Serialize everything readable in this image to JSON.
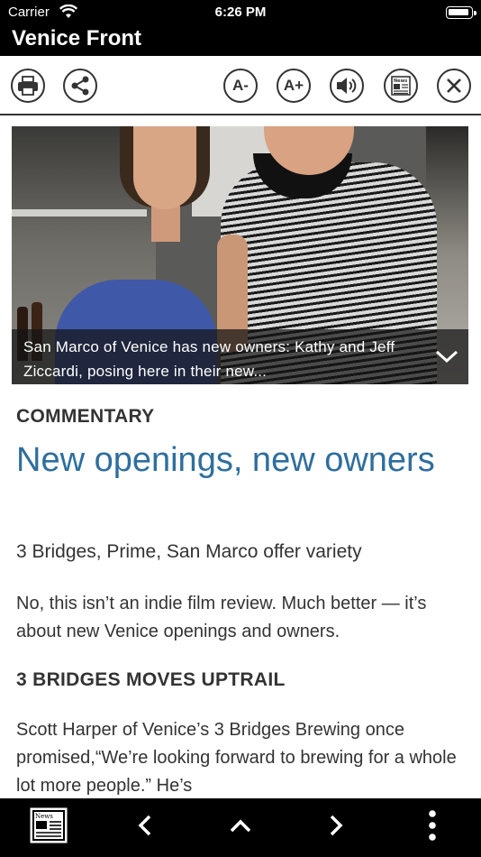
{
  "status_bar": {
    "carrier": "Carrier",
    "time": "6:26 PM"
  },
  "header": {
    "title": "Venice Front"
  },
  "toolbar": {
    "buttons": [
      {
        "icon": "print-icon"
      },
      {
        "icon": "share-icon"
      },
      {
        "label": "A-"
      },
      {
        "label": "A+"
      },
      {
        "icon": "speaker-icon"
      },
      {
        "icon": "news-icon",
        "label": "News"
      },
      {
        "icon": "close-icon"
      }
    ]
  },
  "hero": {
    "caption": "San Marco of Venice has new owners: Kathy and Jeff Ziccardi, posing here in their new..."
  },
  "article": {
    "kicker": "COMMENTARY",
    "headline": "New openings, new owners",
    "dek": "3 Bridges, Prime, San Marco offer variety",
    "paragraph1": "No, this isn’t an indie film review. Much better — it’s about new Venice openings and owners.",
    "subhead": "3 BRIDGES MOVES UPTRAIL",
    "paragraph2": "Scott Harper of Venice’s 3 Bridges Brewing once promised,“We’re looking forward to brewing for a whole lot more people.” He’s"
  },
  "bottom_bar": {
    "news_label": "News",
    "icons": [
      "newspaper-icon",
      "chevron-left-icon",
      "chevron-up-icon",
      "chevron-right-icon",
      "more-vertical-icon"
    ]
  }
}
